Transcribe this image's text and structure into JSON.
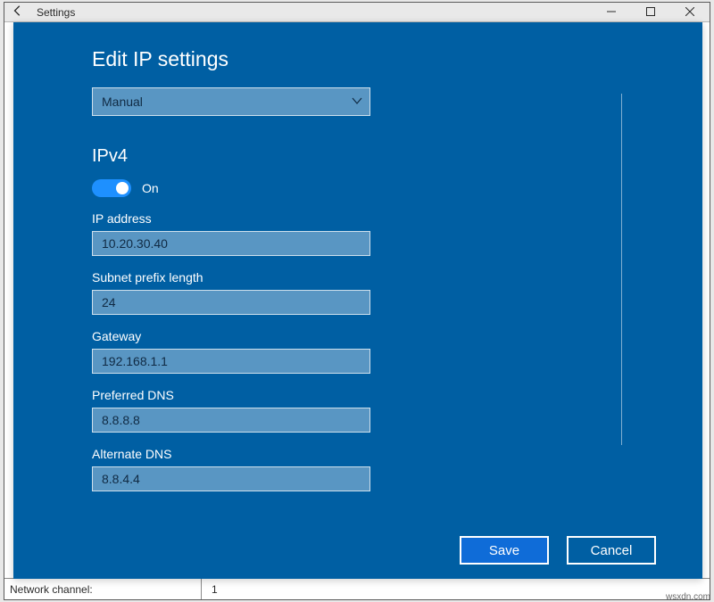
{
  "window": {
    "title": "Settings",
    "under_label": "Network   channel:",
    "under_value": "1"
  },
  "modal": {
    "title": "Edit IP settings",
    "dropdown_value": "Manual",
    "section": "IPv4",
    "toggle_state_label": "On",
    "fields": {
      "ip_label": "IP address",
      "ip_value": "10.20.30.40",
      "prefix_label": "Subnet prefix length",
      "prefix_value": "24",
      "gateway_label": "Gateway",
      "gateway_value": "192.168.1.1",
      "dns1_label": "Preferred DNS",
      "dns1_value": "8.8.8.8",
      "dns2_label": "Alternate DNS",
      "dns2_value": "8.8.4.4"
    },
    "save_label": "Save",
    "cancel_label": "Cancel"
  },
  "watermark": "wsxdn.com"
}
